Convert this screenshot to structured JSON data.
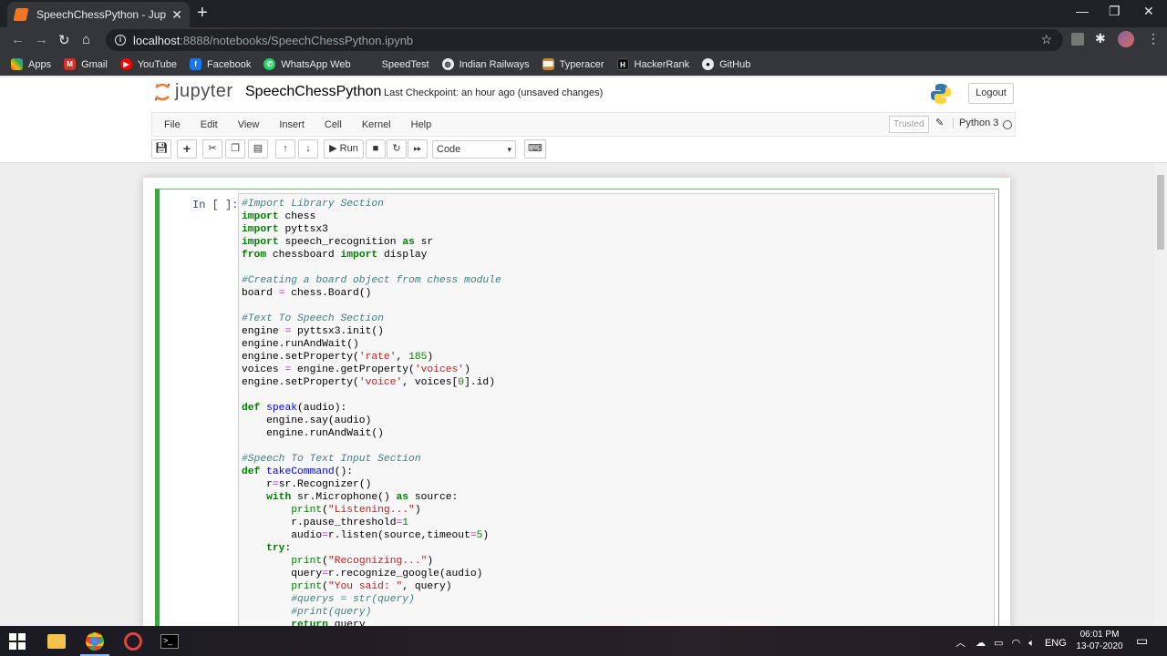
{
  "browser": {
    "tab_title": "SpeechChessPython - Jupyter Ne",
    "new_tab": "+",
    "url_host": "localhost",
    "url_path": ":8888/notebooks/SpeechChessPython.ipynb",
    "bookmarks": [
      "Apps",
      "Gmail",
      "YouTube",
      "Facebook",
      "WhatsApp Web",
      "SpeedTest",
      "Indian Railways",
      "Typeracer",
      "HackerRank",
      "GitHub"
    ]
  },
  "jupyter": {
    "logo_text": "jupyter",
    "notebook_name": "SpeechChessPython",
    "checkpoint": "Last Checkpoint: an hour ago  (unsaved changes)",
    "logout": "Logout",
    "menu": [
      "File",
      "Edit",
      "View",
      "Insert",
      "Cell",
      "Kernel",
      "Help"
    ],
    "trusted": "Trusted",
    "kernel_name": "Python 3",
    "run_label": "Run",
    "cell_type": "Code",
    "prompt": "In [ ]:"
  },
  "code_lines": [
    "#Import Library Section",
    "import chess",
    "import pyttsx3",
    "import speech_recognition as sr",
    "from chessboard import display",
    "",
    "#Creating a board object from chess module",
    "board = chess.Board()",
    "",
    "#Text To Speech Section",
    "engine = pyttsx3.init()",
    "engine.runAndWait()",
    "engine.setProperty('rate', 185)",
    "voices = engine.getProperty('voices')",
    "engine.setProperty('voice', voices[0].id)",
    "",
    "def speak(audio):",
    "    engine.say(audio)",
    "    engine.runAndWait()",
    "",
    "#Speech To Text Input Section",
    "def takeCommand():",
    "    r=sr.Recognizer()",
    "    with sr.Microphone() as source:",
    "        print(\"Listening...\")",
    "        r.pause_threshold=1",
    "        audio=r.listen(source,timeout=5)",
    "    try:",
    "        print(\"Recognizing...\")",
    "        query=r.recognize_google(audio)",
    "        print(\"You said: \", query)",
    "        #querys = str(query)",
    "        #print(query)",
    "        return query"
  ],
  "taskbar": {
    "lang": "ENG",
    "time": "06:01 PM",
    "date": "13-07-2020"
  },
  "colors": {
    "cell_border": "#42a545",
    "comment": "#408080",
    "keyword": "#008000",
    "string": "#ba2121"
  }
}
